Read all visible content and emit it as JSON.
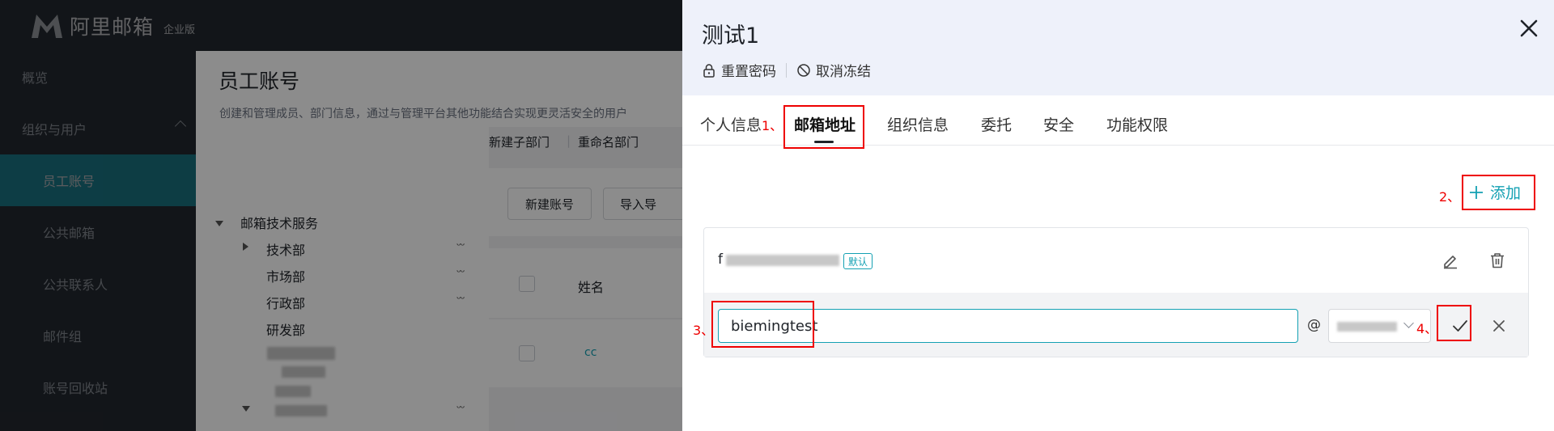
{
  "app": {
    "logo_text": "阿里邮箱",
    "logo_sub": "企业版"
  },
  "sidebar": {
    "items": [
      {
        "label": "概览"
      },
      {
        "label": "组织与用户"
      },
      {
        "label": "员工账号"
      },
      {
        "label": "公共邮箱"
      },
      {
        "label": "公共联系人"
      },
      {
        "label": "邮件组"
      },
      {
        "label": "账号回收站"
      }
    ]
  },
  "page": {
    "title": "员工账号",
    "description": "创建和管理成员、部门信息，通过与管理平台其他功能结合实现更灵活安全的用户"
  },
  "tree": {
    "root": "邮箱技术服务",
    "children": [
      "技术部",
      "市场部",
      "行政部",
      "研发部"
    ]
  },
  "main": {
    "tree_actions": [
      "新建子部门",
      "重命名部门"
    ],
    "new_account": "新建账号",
    "import": "导入导",
    "col_name": "姓名",
    "row_name": "cc"
  },
  "drawer": {
    "title": "测试1",
    "actions": {
      "reset_password": "重置密码",
      "unfreeze": "取消冻结"
    },
    "tabs": [
      "个人信息",
      "邮箱地址",
      "组织信息",
      "委托",
      "安全",
      "功能权限"
    ],
    "active_tab": "邮箱地址",
    "add_label": "添加",
    "default_badge": "默认",
    "address_prefix": "f",
    "edit": {
      "local_part": "biemingtest",
      "at": "@"
    },
    "annotations": [
      "1、",
      "2、",
      "3、",
      "4、"
    ]
  },
  "colors": {
    "accent": "#14a1b3",
    "annotation_red": "#ee0000",
    "sidebar_bg": "#22272e"
  },
  "icons": [
    "lock-icon",
    "ban-icon",
    "close-icon",
    "plus-icon",
    "edit-icon",
    "trash-icon",
    "check-icon",
    "chevron-down-icon",
    "chevron-up-icon",
    "more-icon"
  ]
}
